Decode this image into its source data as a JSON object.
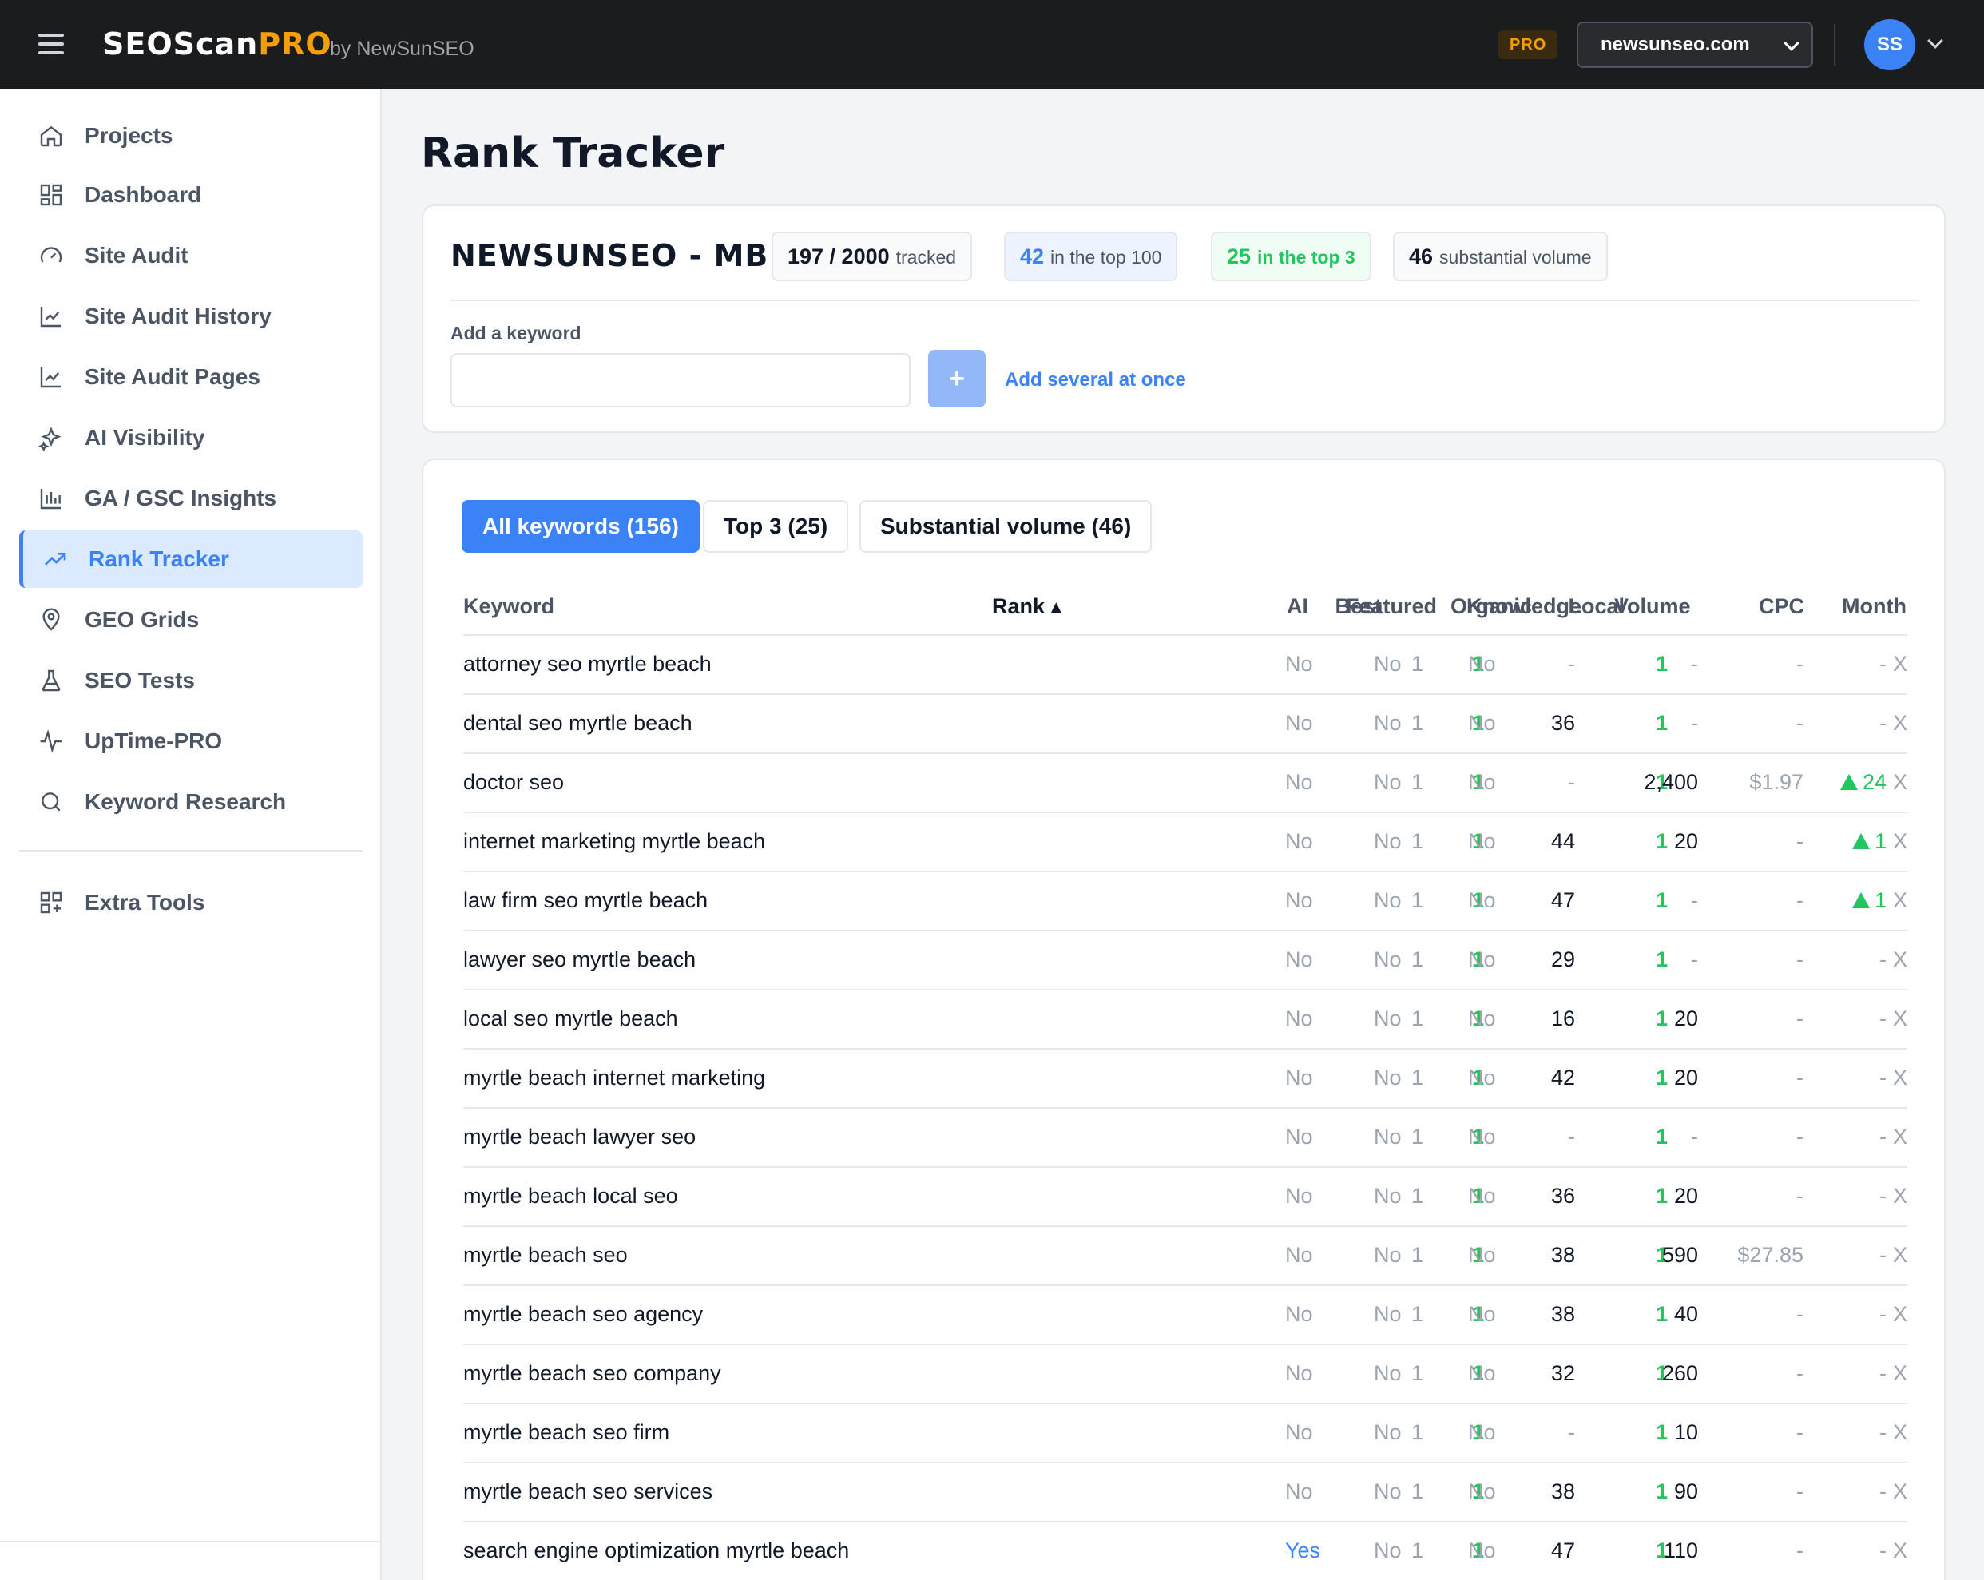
{
  "header": {
    "brand_main": "SEOScan",
    "brand_accent": "PRO",
    "brand_by": "by NewSunSEO",
    "pro_badge": "PRO",
    "site_selected": "newsunseo.com",
    "avatar_initials": "SS"
  },
  "sidebar": {
    "items": [
      {
        "label": "Projects",
        "icon": "home-icon"
      },
      {
        "label": "Dashboard",
        "icon": "grid-icon"
      },
      {
        "label": "Site Audit",
        "icon": "gauge-icon"
      },
      {
        "label": "Site Audit History",
        "icon": "line-chart-icon"
      },
      {
        "label": "Site Audit Pages",
        "icon": "line-chart-icon"
      },
      {
        "label": "AI Visibility",
        "icon": "sparkles-icon"
      },
      {
        "label": "GA / GSC Insights",
        "icon": "bar-chart-icon"
      },
      {
        "label": "Rank Tracker",
        "icon": "trending-up-icon",
        "active": true
      },
      {
        "label": "GEO Grids",
        "icon": "map-pin-icon"
      },
      {
        "label": "SEO Tests",
        "icon": "flask-icon"
      },
      {
        "label": "UpTime-PRO",
        "icon": "activity-icon"
      },
      {
        "label": "Keyword Research",
        "icon": "search-icon"
      },
      {
        "label": "Extra Tools",
        "icon": "grid-plus-icon"
      }
    ]
  },
  "page": {
    "title": "Rank Tracker",
    "project_name": "NEWSUNSEO - MB",
    "stats": {
      "tracked_value": "197 / 2000",
      "tracked_label": "tracked",
      "top100_value": "42",
      "top100_label": "in the top 100",
      "top3_value": "25",
      "top3_label": "in the top 3",
      "volume_value": "46",
      "volume_label": "substantial volume"
    },
    "add_keyword_label": "Add a keyword",
    "add_keyword_placeholder": "",
    "add_button": "+",
    "add_several": "Add several at once"
  },
  "tabs": [
    {
      "label": "All keywords (156)",
      "active": true
    },
    {
      "label": "Top 3 (25)"
    },
    {
      "label": "Substantial volume (46)"
    }
  ],
  "table": {
    "columns": [
      "Keyword",
      "Best",
      "Rank ▴",
      "Organic",
      "Local",
      "AI",
      "Featured",
      "Knowledge",
      "Volume",
      "CPC",
      "Month"
    ],
    "delete_label": "X",
    "rows": [
      {
        "keyword": "attorney seo myrtle beach",
        "best": "1",
        "rank": "1",
        "organic": "-",
        "local": "1",
        "ai": "No",
        "featured": "No",
        "knowledge": "No",
        "volume": "-",
        "cpc": "-",
        "month": "-",
        "month_up": false
      },
      {
        "keyword": "dental seo myrtle beach",
        "best": "1",
        "rank": "1",
        "organic": "36",
        "local": "1",
        "ai": "No",
        "featured": "No",
        "knowledge": "No",
        "volume": "-",
        "cpc": "-",
        "month": "-",
        "month_up": false
      },
      {
        "keyword": "doctor seo",
        "best": "1",
        "rank": "1",
        "organic": "-",
        "local": "1",
        "ai": "No",
        "featured": "No",
        "knowledge": "No",
        "volume": "2,400",
        "cpc": "$1.97",
        "month": "24",
        "month_up": true
      },
      {
        "keyword": "internet marketing myrtle beach",
        "best": "1",
        "rank": "1",
        "organic": "44",
        "local": "1",
        "ai": "No",
        "featured": "No",
        "knowledge": "No",
        "volume": "20",
        "cpc": "-",
        "month": "1",
        "month_up": true
      },
      {
        "keyword": "law firm seo myrtle beach",
        "best": "1",
        "rank": "1",
        "organic": "47",
        "local": "1",
        "ai": "No",
        "featured": "No",
        "knowledge": "No",
        "volume": "-",
        "cpc": "-",
        "month": "1",
        "month_up": true
      },
      {
        "keyword": "lawyer seo myrtle beach",
        "best": "1",
        "rank": "1",
        "organic": "29",
        "local": "1",
        "ai": "No",
        "featured": "No",
        "knowledge": "No",
        "volume": "-",
        "cpc": "-",
        "month": "-",
        "month_up": false
      },
      {
        "keyword": "local seo myrtle beach",
        "best": "1",
        "rank": "1",
        "organic": "16",
        "local": "1",
        "ai": "No",
        "featured": "No",
        "knowledge": "No",
        "volume": "20",
        "cpc": "-",
        "month": "-",
        "month_up": false
      },
      {
        "keyword": "myrtle beach internet marketing",
        "best": "1",
        "rank": "1",
        "organic": "42",
        "local": "1",
        "ai": "No",
        "featured": "No",
        "knowledge": "No",
        "volume": "20",
        "cpc": "-",
        "month": "-",
        "month_up": false
      },
      {
        "keyword": "myrtle beach lawyer seo",
        "best": "1",
        "rank": "1",
        "organic": "-",
        "local": "1",
        "ai": "No",
        "featured": "No",
        "knowledge": "No",
        "volume": "-",
        "cpc": "-",
        "month": "-",
        "month_up": false
      },
      {
        "keyword": "myrtle beach local seo",
        "best": "1",
        "rank": "1",
        "organic": "36",
        "local": "1",
        "ai": "No",
        "featured": "No",
        "knowledge": "No",
        "volume": "20",
        "cpc": "-",
        "month": "-",
        "month_up": false
      },
      {
        "keyword": "myrtle beach seo",
        "best": "1",
        "rank": "1",
        "organic": "38",
        "local": "1",
        "ai": "No",
        "featured": "No",
        "knowledge": "No",
        "volume": "590",
        "cpc": "$27.85",
        "month": "-",
        "month_up": false
      },
      {
        "keyword": "myrtle beach seo agency",
        "best": "1",
        "rank": "1",
        "organic": "38",
        "local": "1",
        "ai": "No",
        "featured": "No",
        "knowledge": "No",
        "volume": "40",
        "cpc": "-",
        "month": "-",
        "month_up": false
      },
      {
        "keyword": "myrtle beach seo company",
        "best": "1",
        "rank": "1",
        "organic": "32",
        "local": "1",
        "ai": "No",
        "featured": "No",
        "knowledge": "No",
        "volume": "260",
        "cpc": "-",
        "month": "-",
        "month_up": false
      },
      {
        "keyword": "myrtle beach seo firm",
        "best": "1",
        "rank": "1",
        "organic": "-",
        "local": "1",
        "ai": "No",
        "featured": "No",
        "knowledge": "No",
        "volume": "10",
        "cpc": "-",
        "month": "-",
        "month_up": false
      },
      {
        "keyword": "myrtle beach seo services",
        "best": "1",
        "rank": "1",
        "organic": "38",
        "local": "1",
        "ai": "No",
        "featured": "No",
        "knowledge": "No",
        "volume": "90",
        "cpc": "-",
        "month": "-",
        "month_up": false
      },
      {
        "keyword": "search engine optimization myrtle beach",
        "best": "1",
        "rank": "1",
        "organic": "47",
        "local": "1",
        "ai": "Yes",
        "featured": "No",
        "knowledge": "No",
        "volume": "110",
        "cpc": "-",
        "month": "-",
        "month_up": false
      }
    ]
  },
  "colors": {
    "accent": "#3b82f6",
    "brand_orange": "#f59e0b",
    "positive": "#22c55e",
    "topbar": "#1b1c1e"
  }
}
